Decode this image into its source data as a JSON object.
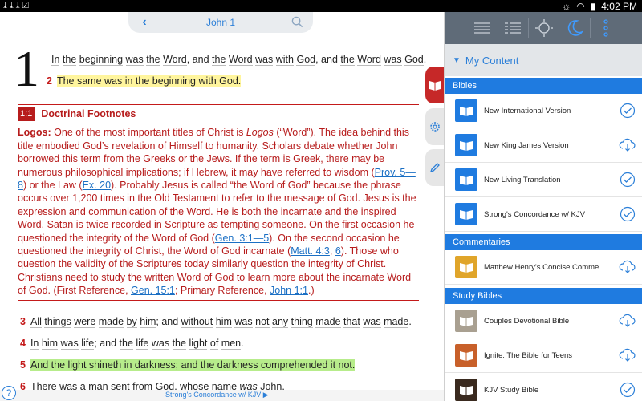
{
  "status_bar": {
    "time": "4:02 PM"
  },
  "reader": {
    "nav_title": "John 1",
    "chapter": "1",
    "verses": {
      "v1": {
        "parts": [
          "In",
          "the",
          "beginning",
          "was",
          "the",
          "Word",
          ", and",
          "the",
          "Word",
          "was",
          "with",
          "God",
          ", and",
          "the",
          "Word",
          "was",
          "God",
          "."
        ]
      },
      "v2": {
        "num": "2",
        "text": "The same was in the beginning with God."
      },
      "v3": {
        "num": "3",
        "parts": [
          "All",
          "things",
          "were",
          "made",
          "by",
          "him",
          "; and",
          "without",
          "him",
          "was",
          "not",
          "any",
          "thing",
          "made",
          "that",
          "was",
          "made",
          "."
        ]
      },
      "v4": {
        "num": "4",
        "parts": [
          "In",
          "him",
          "was",
          "life",
          "; and",
          "the",
          "life",
          "was",
          "the",
          "light",
          "of",
          "men",
          "."
        ]
      },
      "v5": {
        "num": "5",
        "text": "And the light shineth in darkness; and the darkness comprehended it not."
      },
      "v6": {
        "num": "6",
        "text_a": "There was a man sent from God, whose name ",
        "text_i": "was",
        "text_b": " John."
      }
    },
    "footnote": {
      "badge": "1:1",
      "heading": "Doctrinal Footnotes",
      "term": "Logos:",
      "s1": " One of the most important titles of Christ is ",
      "s1i": "Logos",
      "s2": " (“Word”). The idea behind this title embodied God’s revelation of Himself to humanity. Scholars debate whether John borrowed this term from the Greeks or the Jews. If the term is Greek, there may be numerous philosophical implications; if Hebrew, it may have referred to wisdom (",
      "l1": "Prov. 5—8",
      "s3": ") or the Law (",
      "l2": "Ex. 20",
      "s4": "). Probably Jesus is called “the Word of God” because the phrase occurs over 1,200 times in the Old Testament to refer to the message of God. Jesus is the expression and communication of the Word. He is both the incarnate and the inspired Word. Satan is twice recorded in Scripture as tempting someone. On the first occasion he questioned the integrity of the Word of God (",
      "l3": "Gen. 3:1—5",
      "s5": "). On the second occasion he questioned the integrity of Christ, the Word of God incarnate (",
      "l4": "Matt. 4:3",
      "s6": ", ",
      "l5": "6",
      "s7": "). Those who question the validity of the Scriptures today similarly question the integrity of Christ. Christians need to study the written Word of God to learn more about the incarnate Word of God. (First Reference, ",
      "l6": "Gen. 15:1",
      "s8": "; Primary Reference, ",
      "l7": "John 1:1",
      "s9": ".)"
    },
    "bottom_label": "Strong's Concordance w/ KJV ▶"
  },
  "panel": {
    "header": "My Content",
    "sections": {
      "bibles": "Bibles",
      "commentaries": "Commentaries",
      "study_bibles": "Study Bibles"
    },
    "items": [
      {
        "name": "New International Version",
        "status": "downloaded"
      },
      {
        "name": "New King James Version",
        "status": "cloud"
      },
      {
        "name": "New Living Translation",
        "status": "downloaded"
      },
      {
        "name": "Strong's Concordance w/ KJV",
        "status": "downloaded"
      },
      {
        "name": "Matthew Henry's Concise Comme...",
        "status": "cloud"
      },
      {
        "name": "Couples Devotional Bible",
        "status": "cloud"
      },
      {
        "name": "Ignite: The Bible for Teens",
        "status": "cloud"
      },
      {
        "name": "KJV Study Bible",
        "status": "downloaded"
      }
    ]
  },
  "colors": {
    "accent": "#1f7be0",
    "red": "#c41a1a",
    "highlight_yellow": "#fff59d",
    "highlight_green": "#b7ec8b"
  }
}
